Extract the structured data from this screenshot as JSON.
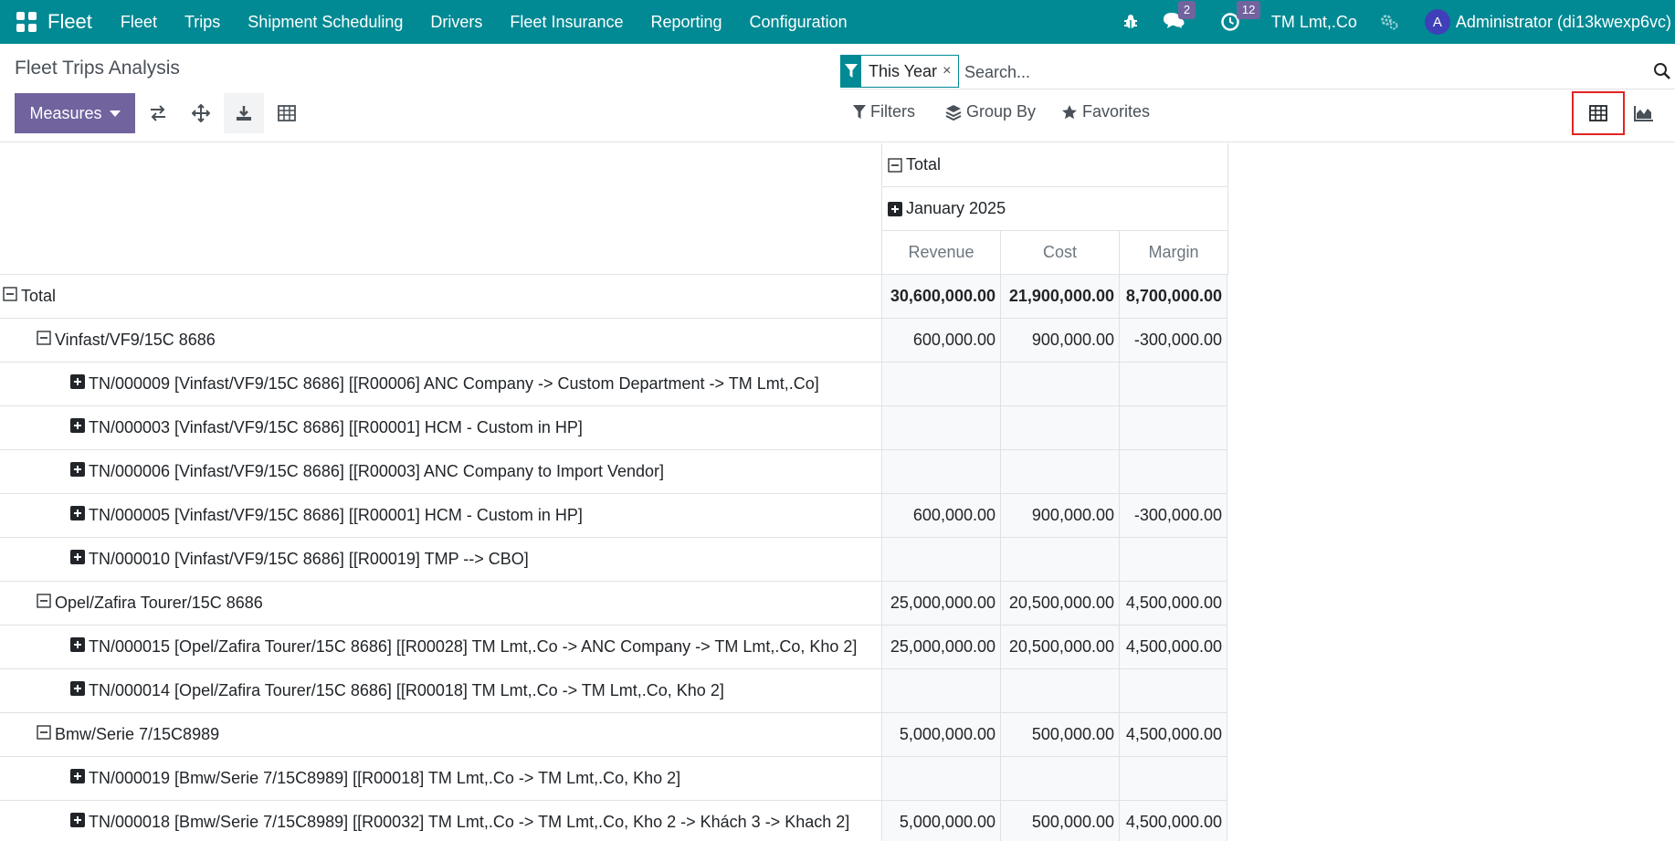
{
  "navbar": {
    "brand": "Fleet",
    "menu": [
      "Fleet",
      "Trips",
      "Shipment Scheduling",
      "Drivers",
      "Fleet Insurance",
      "Reporting",
      "Configuration"
    ],
    "messages_count": "2",
    "activities_count": "12",
    "company": "TM Lmt,.Co",
    "avatar_letter": "A",
    "user": "Administrator (di13kwexp6vc)"
  },
  "control": {
    "title": "Fleet Trips Analysis",
    "measures_label": "Measures",
    "facet_label": "This Year",
    "facet_remove": "×",
    "search_placeholder": "Search...",
    "filters_label": "Filters",
    "groupby_label": "Group By",
    "favorites_label": "Favorites"
  },
  "pivot": {
    "col_total": "Total",
    "col_period": "January 2025",
    "measures": [
      "Revenue",
      "Cost",
      "Margin"
    ],
    "rows": [
      {
        "label": "Total",
        "level": 0,
        "icon": "collapse",
        "bold": true,
        "revenue": "30,600,000.00",
        "cost": "21,900,000.00",
        "margin": "8,700,000.00"
      },
      {
        "label": "Vinfast/VF9/15C 8686",
        "level": 1,
        "icon": "collapse",
        "bold": false,
        "revenue": "600,000.00",
        "cost": "900,000.00",
        "margin": "-300,000.00"
      },
      {
        "label": "TN/000009 [Vinfast/VF9/15C 8686] [[R00006] ANC Company -> Custom Department -> TM Lmt,.Co]",
        "level": 2,
        "icon": "expand",
        "bold": false,
        "revenue": "",
        "cost": "",
        "margin": ""
      },
      {
        "label": "TN/000003 [Vinfast/VF9/15C 8686] [[R00001] HCM - Custom in HP]",
        "level": 2,
        "icon": "expand",
        "bold": false,
        "revenue": "",
        "cost": "",
        "margin": ""
      },
      {
        "label": "TN/000006 [Vinfast/VF9/15C 8686] [[R00003] ANC Company to Import Vendor]",
        "level": 2,
        "icon": "expand",
        "bold": false,
        "revenue": "",
        "cost": "",
        "margin": ""
      },
      {
        "label": "TN/000005 [Vinfast/VF9/15C 8686] [[R00001] HCM - Custom in HP]",
        "level": 2,
        "icon": "expand",
        "bold": false,
        "revenue": "600,000.00",
        "cost": "900,000.00",
        "margin": "-300,000.00"
      },
      {
        "label": "TN/000010 [Vinfast/VF9/15C 8686] [[R00019] TMP --> CBO]",
        "level": 2,
        "icon": "expand",
        "bold": false,
        "revenue": "",
        "cost": "",
        "margin": ""
      },
      {
        "label": "Opel/Zafira Tourer/15C 8686",
        "level": 1,
        "icon": "collapse",
        "bold": false,
        "revenue": "25,000,000.00",
        "cost": "20,500,000.00",
        "margin": "4,500,000.00"
      },
      {
        "label": "TN/000015 [Opel/Zafira Tourer/15C 8686] [[R00028] TM Lmt,.Co -> ANC Company -> TM Lmt,.Co, Kho 2]",
        "level": 2,
        "icon": "expand",
        "bold": false,
        "revenue": "25,000,000.00",
        "cost": "20,500,000.00",
        "margin": "4,500,000.00"
      },
      {
        "label": "TN/000014 [Opel/Zafira Tourer/15C 8686] [[R00018] TM Lmt,.Co -> TM Lmt,.Co, Kho 2]",
        "level": 2,
        "icon": "expand",
        "bold": false,
        "revenue": "",
        "cost": "",
        "margin": ""
      },
      {
        "label": "Bmw/Serie 7/15C8989",
        "level": 1,
        "icon": "collapse",
        "bold": false,
        "revenue": "5,000,000.00",
        "cost": "500,000.00",
        "margin": "4,500,000.00"
      },
      {
        "label": "TN/000019 [Bmw/Serie 7/15C8989] [[R00018] TM Lmt,.Co -> TM Lmt,.Co, Kho 2]",
        "level": 2,
        "icon": "expand",
        "bold": false,
        "revenue": "",
        "cost": "",
        "margin": ""
      },
      {
        "label": "TN/000018 [Bmw/Serie 7/15C8989] [[R00032] TM Lmt,.Co -> TM Lmt,.Co, Kho 2 -> Khách 3 -> Khach 2]",
        "level": 2,
        "icon": "expand",
        "bold": false,
        "revenue": "5,000,000.00",
        "cost": "500,000.00",
        "margin": "4,500,000.00"
      }
    ]
  },
  "colors": {
    "navbar": "#018a94",
    "primary_button": "#71639e",
    "highlight_border": "#e02424"
  }
}
